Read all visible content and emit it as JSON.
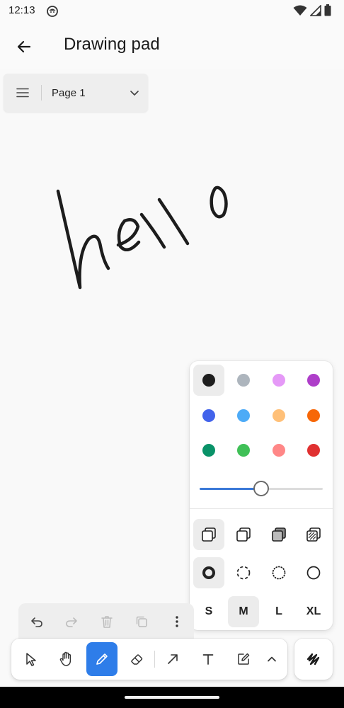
{
  "status_bar": {
    "time": "12:13"
  },
  "app_bar": {
    "title": "Drawing pad",
    "back_icon": "arrow-left-icon"
  },
  "page_menu": {
    "page_label": "Page 1",
    "menu_icon": "hamburger-menu-icon",
    "dropdown_icon": "chevron-down-icon"
  },
  "drawing": {
    "handwritten_text": "hello",
    "stroke_color": "#1d1d1d"
  },
  "style_panel": {
    "colors": [
      {
        "name": "black",
        "hex": "#1d1d1d",
        "selected": true
      },
      {
        "name": "grey",
        "hex": "#adb5bd",
        "selected": false
      },
      {
        "name": "light-violet",
        "hex": "#e599f7",
        "selected": false
      },
      {
        "name": "violet",
        "hex": "#ae3ec9",
        "selected": false
      },
      {
        "name": "blue",
        "hex": "#4263eb",
        "selected": false
      },
      {
        "name": "light-blue",
        "hex": "#4dabf7",
        "selected": false
      },
      {
        "name": "yellow",
        "hex": "#ffc078",
        "selected": false
      },
      {
        "name": "orange",
        "hex": "#f76707",
        "selected": false
      },
      {
        "name": "green",
        "hex": "#099268",
        "selected": false
      },
      {
        "name": "light-green",
        "hex": "#40c057",
        "selected": false
      },
      {
        "name": "light-red",
        "hex": "#ff8787",
        "selected": false
      },
      {
        "name": "red",
        "hex": "#e03131",
        "selected": false
      }
    ],
    "opacity_fraction": 0.5,
    "accent_color": "#3b79d8",
    "fill_options": [
      {
        "name": "fill-none-icon",
        "selected": true
      },
      {
        "name": "fill-semi-icon",
        "selected": false
      },
      {
        "name": "fill-solid-icon",
        "selected": false
      },
      {
        "name": "fill-pattern-icon",
        "selected": false
      }
    ],
    "dash_options": [
      {
        "name": "dash-draw-icon",
        "selected": true
      },
      {
        "name": "dash-dashed-icon",
        "selected": false
      },
      {
        "name": "dash-dotted-icon",
        "selected": false
      },
      {
        "name": "dash-solid-icon",
        "selected": false
      }
    ],
    "sizes": [
      {
        "label": "S",
        "selected": false
      },
      {
        "label": "M",
        "selected": true
      },
      {
        "label": "L",
        "selected": false
      },
      {
        "label": "XL",
        "selected": false
      }
    ]
  },
  "action_bar": {
    "items": [
      "undo-icon",
      "redo-icon",
      "trash-icon",
      "duplicate-icon",
      "more-vertical-icon"
    ]
  },
  "toolbar": {
    "tools": [
      {
        "name": "select-tool",
        "icon": "cursor-arrow-icon",
        "active": false
      },
      {
        "name": "hand-tool",
        "icon": "hand-icon",
        "active": false
      },
      {
        "name": "draw-tool",
        "icon": "pencil-icon",
        "active": true
      },
      {
        "name": "eraser-tool",
        "icon": "eraser-icon",
        "active": false
      },
      {
        "name": "arrow-tool",
        "icon": "arrow-up-right-icon",
        "active": false
      },
      {
        "name": "text-tool",
        "icon": "text-t-icon",
        "active": false
      },
      {
        "name": "note-tool",
        "icon": "note-edit-icon",
        "active": false
      },
      {
        "name": "more-tools",
        "icon": "chevron-up-icon",
        "active": false
      }
    ],
    "active_color": "#2e7de9",
    "style_toggle_icon": "scribble-icon"
  }
}
